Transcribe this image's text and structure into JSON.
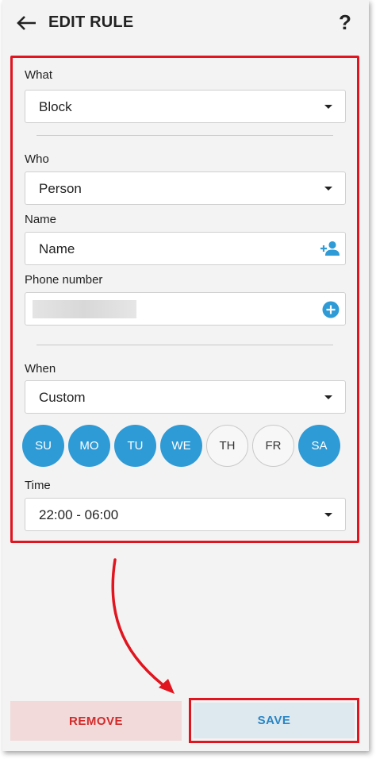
{
  "header": {
    "title": "EDIT RULE",
    "help": "?"
  },
  "what": {
    "label": "What",
    "value": "Block"
  },
  "who": {
    "label": "Who",
    "value": "Person"
  },
  "name": {
    "label": "Name",
    "placeholder": "Name"
  },
  "phone": {
    "label": "Phone number",
    "value": ""
  },
  "when": {
    "label": "When",
    "value": "Custom"
  },
  "days": [
    {
      "label": "SU",
      "selected": true
    },
    {
      "label": "MO",
      "selected": true
    },
    {
      "label": "TU",
      "selected": true
    },
    {
      "label": "WE",
      "selected": true
    },
    {
      "label": "TH",
      "selected": false
    },
    {
      "label": "FR",
      "selected": false
    },
    {
      "label": "SA",
      "selected": true
    }
  ],
  "time": {
    "label": "Time",
    "value": "22:00 - 06:00"
  },
  "actions": {
    "remove": "REMOVE",
    "save": "SAVE"
  },
  "colors": {
    "accent": "#2e9bd6",
    "highlight": "#e0151f",
    "remove_text": "#d12b2b"
  }
}
